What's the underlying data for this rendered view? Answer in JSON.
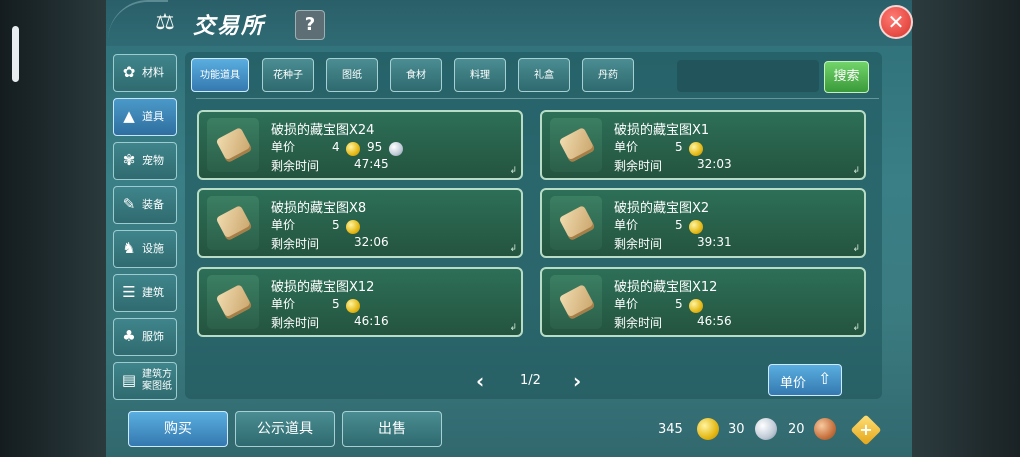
{
  "header": {
    "title": "交易所",
    "help": "?",
    "close": "✕"
  },
  "side_tabs": [
    {
      "label": "材料",
      "icon": "materials-icon",
      "glyph": "✿"
    },
    {
      "label": "道具",
      "icon": "item-icon",
      "glyph": "▲"
    },
    {
      "label": "宠物",
      "icon": "pet-paw-icon",
      "glyph": "✾"
    },
    {
      "label": "装备",
      "icon": "equipment-icon",
      "glyph": "✎"
    },
    {
      "label": "设施",
      "icon": "facility-icon",
      "glyph": "♞"
    },
    {
      "label": "建筑",
      "icon": "building-icon",
      "glyph": "☰"
    },
    {
      "label": "服饰",
      "icon": "clothing-icon",
      "glyph": "♣"
    },
    {
      "label": "建筑方案图纸",
      "icon": "blueprint-icon",
      "glyph": "▤"
    }
  ],
  "category_tabs": [
    "功能道具",
    "花种子",
    "图纸",
    "食材",
    "料理",
    "礼盒",
    "丹药"
  ],
  "search": {
    "placeholder": "",
    "button": "搜索"
  },
  "listings": [
    {
      "name": "破损的藏宝图X24",
      "price_label": "单价",
      "price_gold": "4",
      "price_silver": "95",
      "time_label": "剩余时间",
      "time": "47:45"
    },
    {
      "name": "破损的藏宝图X1",
      "price_label": "单价",
      "price_gold": "5",
      "price_silver": "",
      "time_label": "剩余时间",
      "time": "32:03"
    },
    {
      "name": "破损的藏宝图X8",
      "price_label": "单价",
      "price_gold": "5",
      "price_silver": "",
      "time_label": "剩余时间",
      "time": "32:06"
    },
    {
      "name": "破损的藏宝图X2",
      "price_label": "单价",
      "price_gold": "5",
      "price_silver": "",
      "time_label": "剩余时间",
      "time": "39:31"
    },
    {
      "name": "破损的藏宝图X12",
      "price_label": "单价",
      "price_gold": "5",
      "price_silver": "",
      "time_label": "剩余时间",
      "time": "46:16"
    },
    {
      "name": "破损的藏宝图X12",
      "price_label": "单价",
      "price_gold": "5",
      "price_silver": "",
      "time_label": "剩余时间",
      "time": "46:56"
    }
  ],
  "pager": {
    "text": "1/2",
    "prev": "‹",
    "next": "›"
  },
  "sort": {
    "label": "单价",
    "arrow": "⇧"
  },
  "bottom": {
    "buy": "购买",
    "public": "公示道具",
    "sell": "出售"
  },
  "currency": {
    "gold": "345",
    "silver": "30",
    "bronze": "20",
    "add": "+"
  }
}
